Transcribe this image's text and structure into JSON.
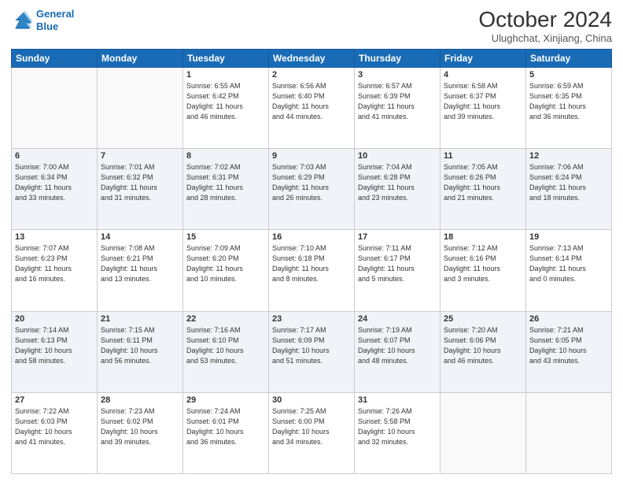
{
  "header": {
    "logo_line1": "General",
    "logo_line2": "Blue",
    "month_title": "October 2024",
    "location": "Ulughchat, Xinjiang, China"
  },
  "weekdays": [
    "Sunday",
    "Monday",
    "Tuesday",
    "Wednesday",
    "Thursday",
    "Friday",
    "Saturday"
  ],
  "weeks": [
    [
      {
        "day": "",
        "info": ""
      },
      {
        "day": "",
        "info": ""
      },
      {
        "day": "1",
        "info": "Sunrise: 6:55 AM\nSunset: 6:42 PM\nDaylight: 11 hours\nand 46 minutes."
      },
      {
        "day": "2",
        "info": "Sunrise: 6:56 AM\nSunset: 6:40 PM\nDaylight: 11 hours\nand 44 minutes."
      },
      {
        "day": "3",
        "info": "Sunrise: 6:57 AM\nSunset: 6:39 PM\nDaylight: 11 hours\nand 41 minutes."
      },
      {
        "day": "4",
        "info": "Sunrise: 6:58 AM\nSunset: 6:37 PM\nDaylight: 11 hours\nand 39 minutes."
      },
      {
        "day": "5",
        "info": "Sunrise: 6:59 AM\nSunset: 6:35 PM\nDaylight: 11 hours\nand 36 minutes."
      }
    ],
    [
      {
        "day": "6",
        "info": "Sunrise: 7:00 AM\nSunset: 6:34 PM\nDaylight: 11 hours\nand 33 minutes."
      },
      {
        "day": "7",
        "info": "Sunrise: 7:01 AM\nSunset: 6:32 PM\nDaylight: 11 hours\nand 31 minutes."
      },
      {
        "day": "8",
        "info": "Sunrise: 7:02 AM\nSunset: 6:31 PM\nDaylight: 11 hours\nand 28 minutes."
      },
      {
        "day": "9",
        "info": "Sunrise: 7:03 AM\nSunset: 6:29 PM\nDaylight: 11 hours\nand 26 minutes."
      },
      {
        "day": "10",
        "info": "Sunrise: 7:04 AM\nSunset: 6:28 PM\nDaylight: 11 hours\nand 23 minutes."
      },
      {
        "day": "11",
        "info": "Sunrise: 7:05 AM\nSunset: 6:26 PM\nDaylight: 11 hours\nand 21 minutes."
      },
      {
        "day": "12",
        "info": "Sunrise: 7:06 AM\nSunset: 6:24 PM\nDaylight: 11 hours\nand 18 minutes."
      }
    ],
    [
      {
        "day": "13",
        "info": "Sunrise: 7:07 AM\nSunset: 6:23 PM\nDaylight: 11 hours\nand 16 minutes."
      },
      {
        "day": "14",
        "info": "Sunrise: 7:08 AM\nSunset: 6:21 PM\nDaylight: 11 hours\nand 13 minutes."
      },
      {
        "day": "15",
        "info": "Sunrise: 7:09 AM\nSunset: 6:20 PM\nDaylight: 11 hours\nand 10 minutes."
      },
      {
        "day": "16",
        "info": "Sunrise: 7:10 AM\nSunset: 6:18 PM\nDaylight: 11 hours\nand 8 minutes."
      },
      {
        "day": "17",
        "info": "Sunrise: 7:11 AM\nSunset: 6:17 PM\nDaylight: 11 hours\nand 5 minutes."
      },
      {
        "day": "18",
        "info": "Sunrise: 7:12 AM\nSunset: 6:16 PM\nDaylight: 11 hours\nand 3 minutes."
      },
      {
        "day": "19",
        "info": "Sunrise: 7:13 AM\nSunset: 6:14 PM\nDaylight: 11 hours\nand 0 minutes."
      }
    ],
    [
      {
        "day": "20",
        "info": "Sunrise: 7:14 AM\nSunset: 6:13 PM\nDaylight: 10 hours\nand 58 minutes."
      },
      {
        "day": "21",
        "info": "Sunrise: 7:15 AM\nSunset: 6:11 PM\nDaylight: 10 hours\nand 56 minutes."
      },
      {
        "day": "22",
        "info": "Sunrise: 7:16 AM\nSunset: 6:10 PM\nDaylight: 10 hours\nand 53 minutes."
      },
      {
        "day": "23",
        "info": "Sunrise: 7:17 AM\nSunset: 6:09 PM\nDaylight: 10 hours\nand 51 minutes."
      },
      {
        "day": "24",
        "info": "Sunrise: 7:19 AM\nSunset: 6:07 PM\nDaylight: 10 hours\nand 48 minutes."
      },
      {
        "day": "25",
        "info": "Sunrise: 7:20 AM\nSunset: 6:06 PM\nDaylight: 10 hours\nand 46 minutes."
      },
      {
        "day": "26",
        "info": "Sunrise: 7:21 AM\nSunset: 6:05 PM\nDaylight: 10 hours\nand 43 minutes."
      }
    ],
    [
      {
        "day": "27",
        "info": "Sunrise: 7:22 AM\nSunset: 6:03 PM\nDaylight: 10 hours\nand 41 minutes."
      },
      {
        "day": "28",
        "info": "Sunrise: 7:23 AM\nSunset: 6:02 PM\nDaylight: 10 hours\nand 39 minutes."
      },
      {
        "day": "29",
        "info": "Sunrise: 7:24 AM\nSunset: 6:01 PM\nDaylight: 10 hours\nand 36 minutes."
      },
      {
        "day": "30",
        "info": "Sunrise: 7:25 AM\nSunset: 6:00 PM\nDaylight: 10 hours\nand 34 minutes."
      },
      {
        "day": "31",
        "info": "Sunrise: 7:26 AM\nSunset: 5:58 PM\nDaylight: 10 hours\nand 32 minutes."
      },
      {
        "day": "",
        "info": ""
      },
      {
        "day": "",
        "info": ""
      }
    ]
  ]
}
